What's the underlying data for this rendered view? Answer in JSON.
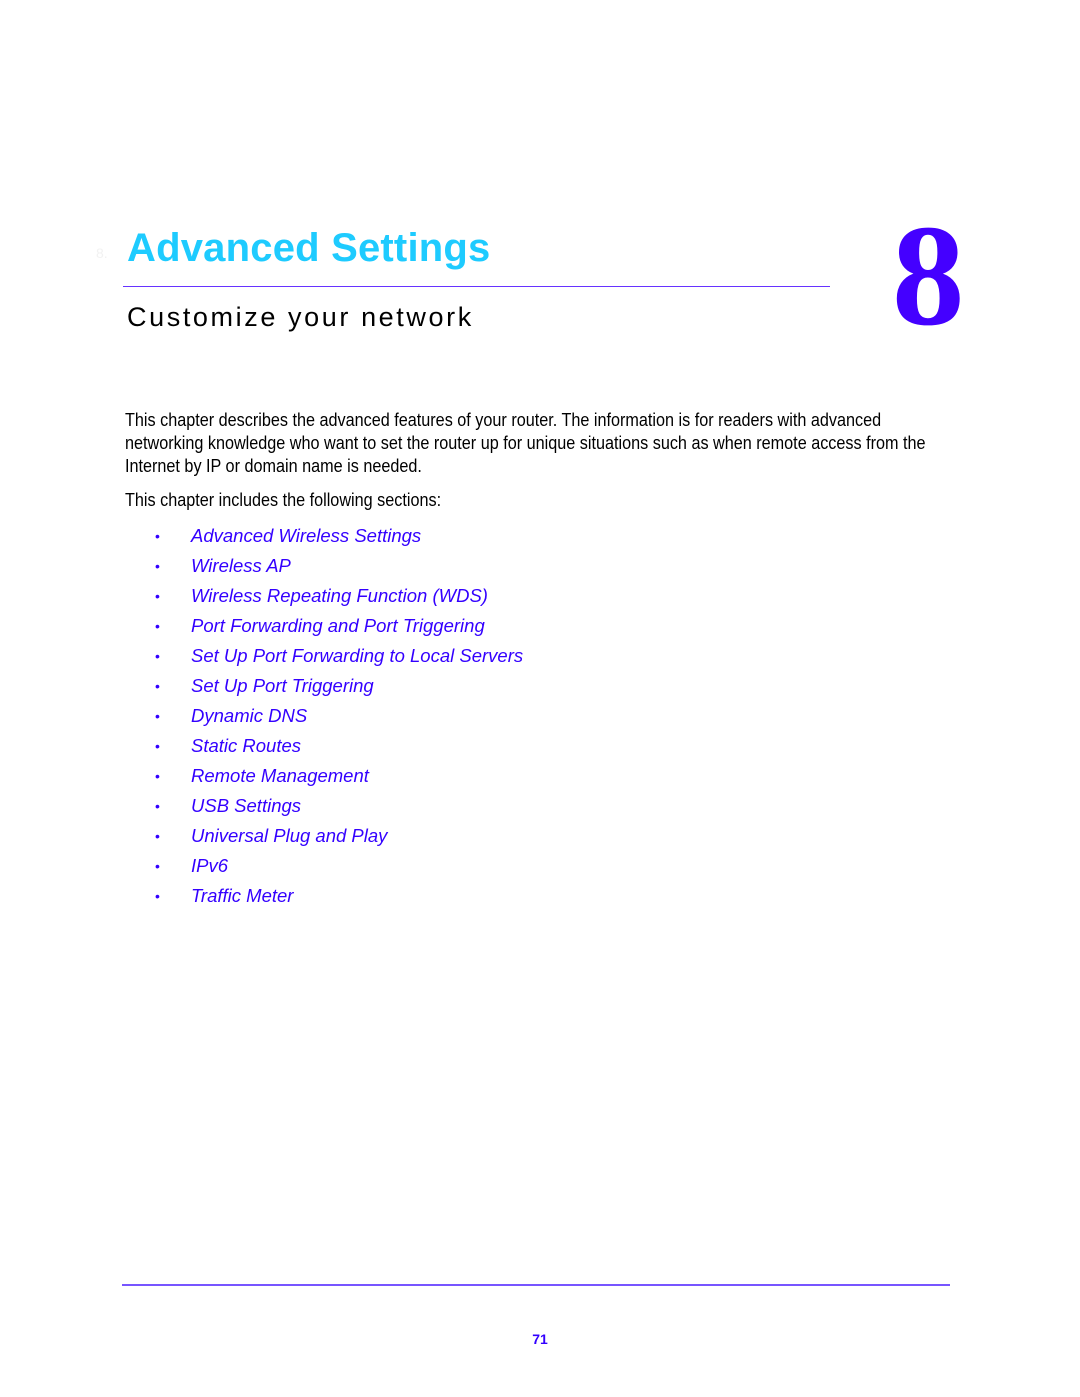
{
  "chapter": {
    "prefix": "8.",
    "title": "Advanced Settings",
    "number": "8",
    "subtitle": "Customize your network"
  },
  "intro": {
    "paragraph": "This chapter describes the advanced features of your router. The information is for readers with advanced networking knowledge who want to set the router up for unique situations such as when remote access from the Internet by IP or domain name is needed.",
    "sections_lead": "This chapter includes the following sections:"
  },
  "toc": {
    "bullet": "•",
    "items": [
      {
        "label": "Advanced Wireless Settings"
      },
      {
        "label": "Wireless AP"
      },
      {
        "label": "Wireless Repeating Function (WDS)"
      },
      {
        "label": "Port Forwarding and Port Triggering"
      },
      {
        "label": "Set Up Port Forwarding to Local Servers"
      },
      {
        "label": "Set Up Port Triggering"
      },
      {
        "label": "Dynamic DNS"
      },
      {
        "label": "Static Routes"
      },
      {
        "label": "Remote Management"
      },
      {
        "label": "USB Settings"
      },
      {
        "label": "Universal Plug and Play"
      },
      {
        "label": "IPv6"
      },
      {
        "label": "Traffic Meter"
      }
    ]
  },
  "footer": {
    "page_number": "71"
  },
  "colors": {
    "title": "#1ecbff",
    "accent": "#3300ff",
    "chapter_number": "#4400ff"
  }
}
